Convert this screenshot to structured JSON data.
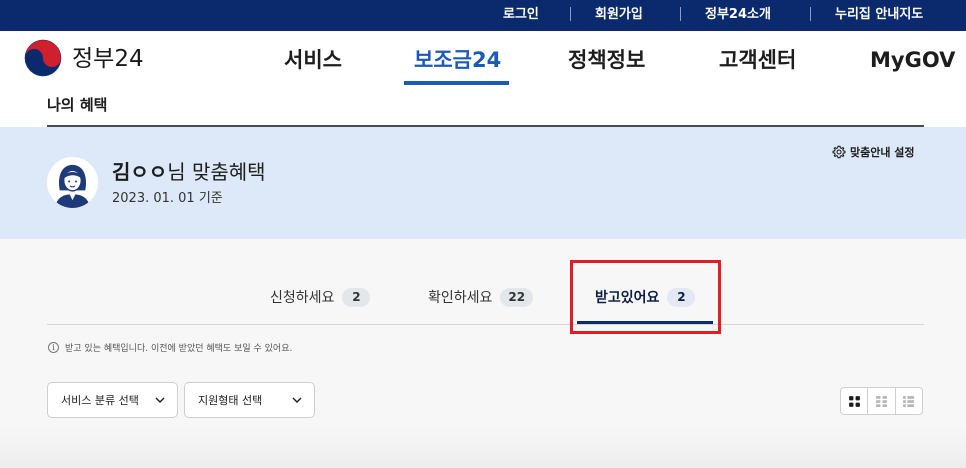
{
  "utility_nav": {
    "links": [
      "로그인",
      "회원가입",
      "정부24소개",
      "누리집 안내지도"
    ]
  },
  "header": {
    "logo_text": "정부24",
    "nav": [
      {
        "label": "서비스",
        "active": false
      },
      {
        "label": "보조금24",
        "active": true
      },
      {
        "label": "정책정보",
        "active": false
      },
      {
        "label": "고객센터",
        "active": false
      },
      {
        "label": "MyGOV",
        "active": false
      }
    ]
  },
  "page": {
    "title": "나의 혜택"
  },
  "profile": {
    "name": "김ㅇㅇ",
    "greeting_suffix": "님 맞춤혜택",
    "date": "2023. 01. 01 기준",
    "settings_label": "맞춤안내 설정"
  },
  "tabs": [
    {
      "label": "신청하세요",
      "count": "2",
      "active": false
    },
    {
      "label": "확인하세요",
      "count": "22",
      "active": false
    },
    {
      "label": "받고있어요",
      "count": "2",
      "active": true
    }
  ],
  "info_text": "받고 있는 혜택입니다. 이전에 받았던 혜택도 보일 수 있어요.",
  "filters": {
    "service_category": "서비스 분류 선택",
    "support_type": "지원형태 선택"
  },
  "colors": {
    "topbar": "#0b2a6e",
    "brand_blue": "#1b5ab6",
    "profile_bg": "#dde9f9",
    "highlight": "#e11e25"
  },
  "icons": [
    "taegeuk-logo-icon",
    "gear-icon",
    "info-icon",
    "chevron-down-icon",
    "grid-view-icon",
    "card-view-icon",
    "list-view-icon"
  ]
}
